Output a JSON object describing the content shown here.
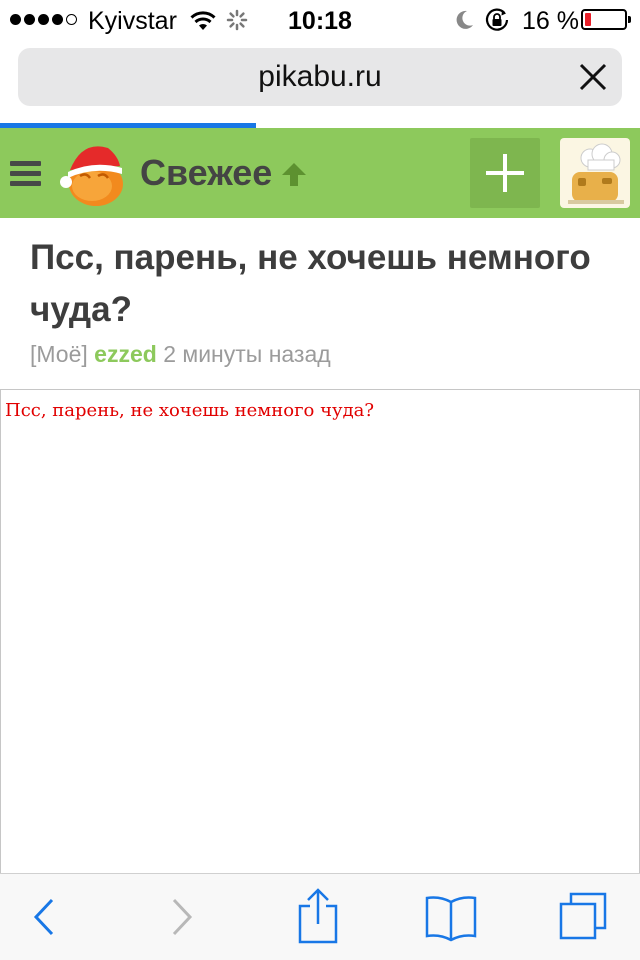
{
  "status_bar": {
    "carrier": "Kyivstar",
    "time": "10:18",
    "battery_text": "16 %",
    "battery_level": 0.16,
    "signal_dots": 5,
    "signal_filled": 4
  },
  "browser": {
    "url": "pikabu.ru",
    "load_progress": 0.4
  },
  "header": {
    "section_title": "Свежее"
  },
  "post": {
    "title": "Псс, парень, не хочешь немного чуда?",
    "tag": "[Моё]",
    "author": "ezzed",
    "time_ago": "2 минуты назад",
    "embed_text": "Псс, парень, не хочешь немного чуда?"
  },
  "colors": {
    "header_green": "#8dc95c",
    "author_green": "#8dc95c",
    "embed_red": "#e10000",
    "ios_blue": "#1877e6"
  },
  "icons": {
    "menu": "hamburger-icon",
    "logo": "pikabu-santa-logo",
    "add": "plus-icon",
    "back": "chevron-left-icon",
    "forward": "chevron-right-icon",
    "share": "share-icon",
    "bookmarks": "book-icon",
    "tabs": "tabs-icon"
  }
}
